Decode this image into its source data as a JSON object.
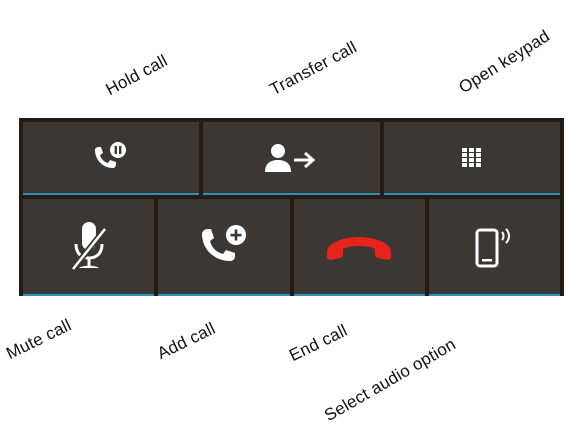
{
  "callouts": {
    "hold": "Hold call",
    "transfer": "Transfer call",
    "keypad": "Open keypad",
    "mute": "Mute call",
    "add": "Add call",
    "end": "End call",
    "audio": "Select audio option"
  },
  "buttons": {
    "top": [
      {
        "name": "hold-call-button",
        "icon": "phone-pause-icon"
      },
      {
        "name": "transfer-call-button",
        "icon": "person-transfer-icon"
      },
      {
        "name": "open-keypad-button",
        "icon": "keypad-icon"
      }
    ],
    "bottom": [
      {
        "name": "mute-call-button",
        "icon": "mic-muted-icon"
      },
      {
        "name": "add-call-button",
        "icon": "phone-add-icon"
      },
      {
        "name": "end-call-button",
        "icon": "hangup-icon"
      },
      {
        "name": "audio-option-button",
        "icon": "phone-speaker-icon"
      }
    ]
  },
  "colors": {
    "panel_border": "#241c14",
    "button_bg": "#3a3734",
    "accent_line": "#2f8fb8",
    "icon": "#ffffff",
    "end_call": "#e8221c"
  }
}
